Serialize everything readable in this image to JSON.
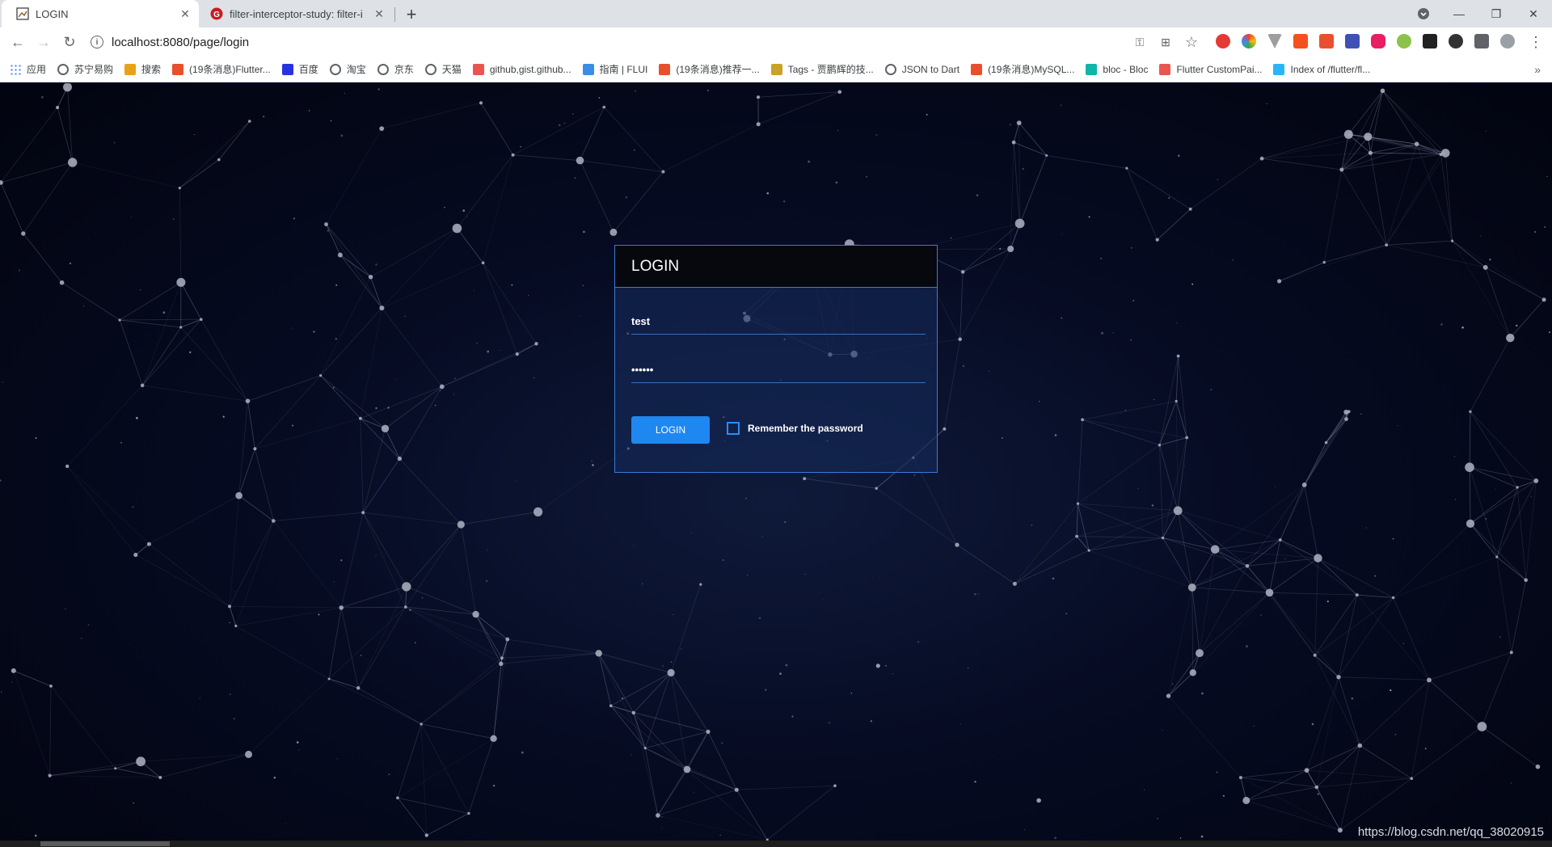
{
  "browser": {
    "tabs": [
      {
        "title": "LOGIN",
        "active": true,
        "icon": "image-favicon-icon"
      },
      {
        "title": "filter-interceptor-study: filter-i",
        "active": false,
        "icon": "gitee-favicon-icon"
      }
    ],
    "url": "localhost:8080/page/login",
    "bookmarks": [
      {
        "label": "应用",
        "icon": "apps-grid-icon",
        "color": "#4285f4"
      },
      {
        "label": "苏宁易购",
        "icon": "globe-icon",
        "color": "#5f6368"
      },
      {
        "label": "搜索",
        "icon": "search-circle-icon",
        "color": "#e8a21a"
      },
      {
        "label": "(19条消息)Flutter...",
        "icon": "csdn-icon",
        "color": "#e94f2e"
      },
      {
        "label": "百度",
        "icon": "baidu-paw-icon",
        "color": "#2932e1"
      },
      {
        "label": "淘宝",
        "icon": "globe-icon",
        "color": "#5f6368"
      },
      {
        "label": "京东",
        "icon": "globe-icon",
        "color": "#5f6368"
      },
      {
        "label": "天猫",
        "icon": "globe-icon",
        "color": "#5f6368"
      },
      {
        "label": "github,gist.github...",
        "icon": "jianshu-icon",
        "color": "#e9564f"
      },
      {
        "label": "指南 | FLUI",
        "icon": "fluid-drop-icon",
        "color": "#3a8ee6"
      },
      {
        "label": "(19条消息)推荐一...",
        "icon": "csdn-icon",
        "color": "#e94f2e"
      },
      {
        "label": "Tags - 贾鹏辉的技...",
        "icon": "landscape-icon",
        "color": "#c9a227"
      },
      {
        "label": "JSON to Dart",
        "icon": "globe-icon",
        "color": "#5f6368"
      },
      {
        "label": "(19条消息)MySQL...",
        "icon": "csdn-icon",
        "color": "#e94f2e"
      },
      {
        "label": "bloc - Bloc",
        "icon": "bloc-hex-icon",
        "color": "#11b5a8"
      },
      {
        "label": "Flutter CustomPai...",
        "icon": "jianshu-icon",
        "color": "#e9564f"
      },
      {
        "label": "Index of /flutter/fl...",
        "icon": "flutter-bird-icon",
        "color": "#29b6f6"
      }
    ],
    "more_label": "»"
  },
  "login": {
    "heading": "LOGIN",
    "username_value": "test",
    "password_value": "••••••",
    "button_label": "LOGIN",
    "remember_label": "Remember the password",
    "remember_checked": false
  },
  "watermark": "https://blog.csdn.net/qq_38020915"
}
